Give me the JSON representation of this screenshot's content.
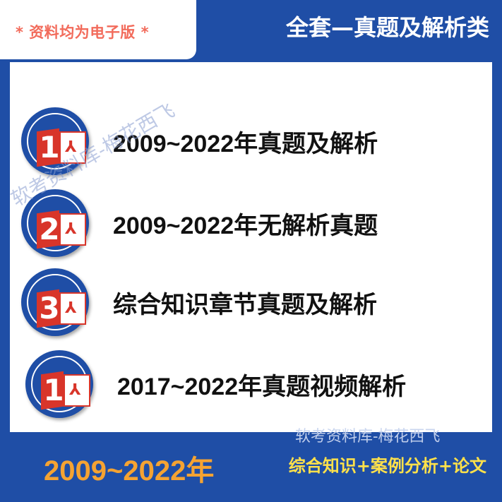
{
  "header": {
    "left_label": "* 资料均为电子版 *",
    "right_title": "全套—真题及解析类"
  },
  "items": [
    {
      "number": "1",
      "label": "2009~2022年真题及解析"
    },
    {
      "number": "2",
      "label": "2009~2022年无解析真题"
    },
    {
      "number": "3",
      "label": "综合知识章节真题及解析"
    },
    {
      "number": "1",
      "label": "2017~2022年真题视频解析"
    }
  ],
  "watermark": {
    "top_left": "软考资料库-梅花西飞",
    "bottom_right": "软考资料库-梅花西飞"
  },
  "footer": {
    "year_range": "2009~2022年",
    "subjects": "综合知识+案例分析+论文"
  },
  "colors": {
    "frame_blue": "#1f4ea6",
    "accent_red": "#d8352a",
    "header_label_red": "#f26b5b",
    "footer_orange": "#f5a332",
    "footer_yellow": "#ffe14a"
  },
  "icons": [
    "pdf-document-icon"
  ]
}
